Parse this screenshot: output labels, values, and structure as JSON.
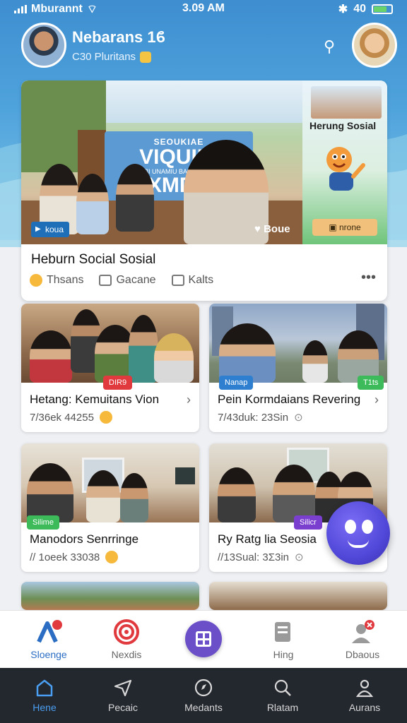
{
  "status_bar": {
    "carrier": "Mburannt",
    "time": "3.09 AM",
    "battery": "40"
  },
  "header": {
    "name": "Nebarans 1ϐ",
    "subtitle": "Ϲ30 Ρluritans"
  },
  "hero": {
    "sign_line1": "SEOUKIAE",
    "sign_line2": "VIQUIIA",
    "sign_line3": "BI UNAMIU BAFCHKAN",
    "sign_line4": "XMDA",
    "tag": "koua",
    "badge": "Boue",
    "side_title": "Herung Sosial",
    "side_button": "nrone",
    "title": "Heburn Social Sosial",
    "meta": [
      "Thsans",
      "Gacane",
      "Kalts"
    ]
  },
  "cards": [
    {
      "title": "Hetang: Kemuitans Vion",
      "meta": "7/36ek 44255",
      "pill": "DIR9",
      "pill_color": "#e0393e"
    },
    {
      "title": "Pein Kormdaians Revering",
      "meta": "7/43duk: 23Sin",
      "pill": "Nanap",
      "pill_color": "#2f7fd0",
      "pill2": "T1ts",
      "pill2_color": "#3dbb5b"
    },
    {
      "title": "Manodors Senrringe",
      "meta": "// 1oeek 33038",
      "pill": "Silime",
      "pill_color": "#3dbb5b"
    },
    {
      "title": "Ry Ratg lia Seosia",
      "meta": "//13Sual: 3Σ3in",
      "pill": "Silicr",
      "pill_color": "#7b3fcf"
    }
  ],
  "tabs_top": [
    {
      "label": "Sloenge",
      "icon": "app-logo-icon"
    },
    {
      "label": "Nexdis",
      "icon": "target-icon"
    },
    {
      "label": "",
      "icon": "grid-icon"
    },
    {
      "label": "Hing",
      "icon": "document-icon"
    },
    {
      "label": "Dbaous",
      "icon": "user-alert-icon"
    }
  ],
  "tabs_bottom": [
    {
      "label": "Hene",
      "icon": "home-icon"
    },
    {
      "label": "Pecaic",
      "icon": "send-icon"
    },
    {
      "label": "Medants",
      "icon": "compass-icon"
    },
    {
      "label": "Rlatam",
      "icon": "search-icon"
    },
    {
      "label": "Aurans",
      "icon": "person-icon"
    }
  ],
  "colors": {
    "accent": "#2a6dc3",
    "header_bg": "#4fa3dc",
    "center_button": "#6a4fc9",
    "bottom_bar": "#23272e"
  }
}
